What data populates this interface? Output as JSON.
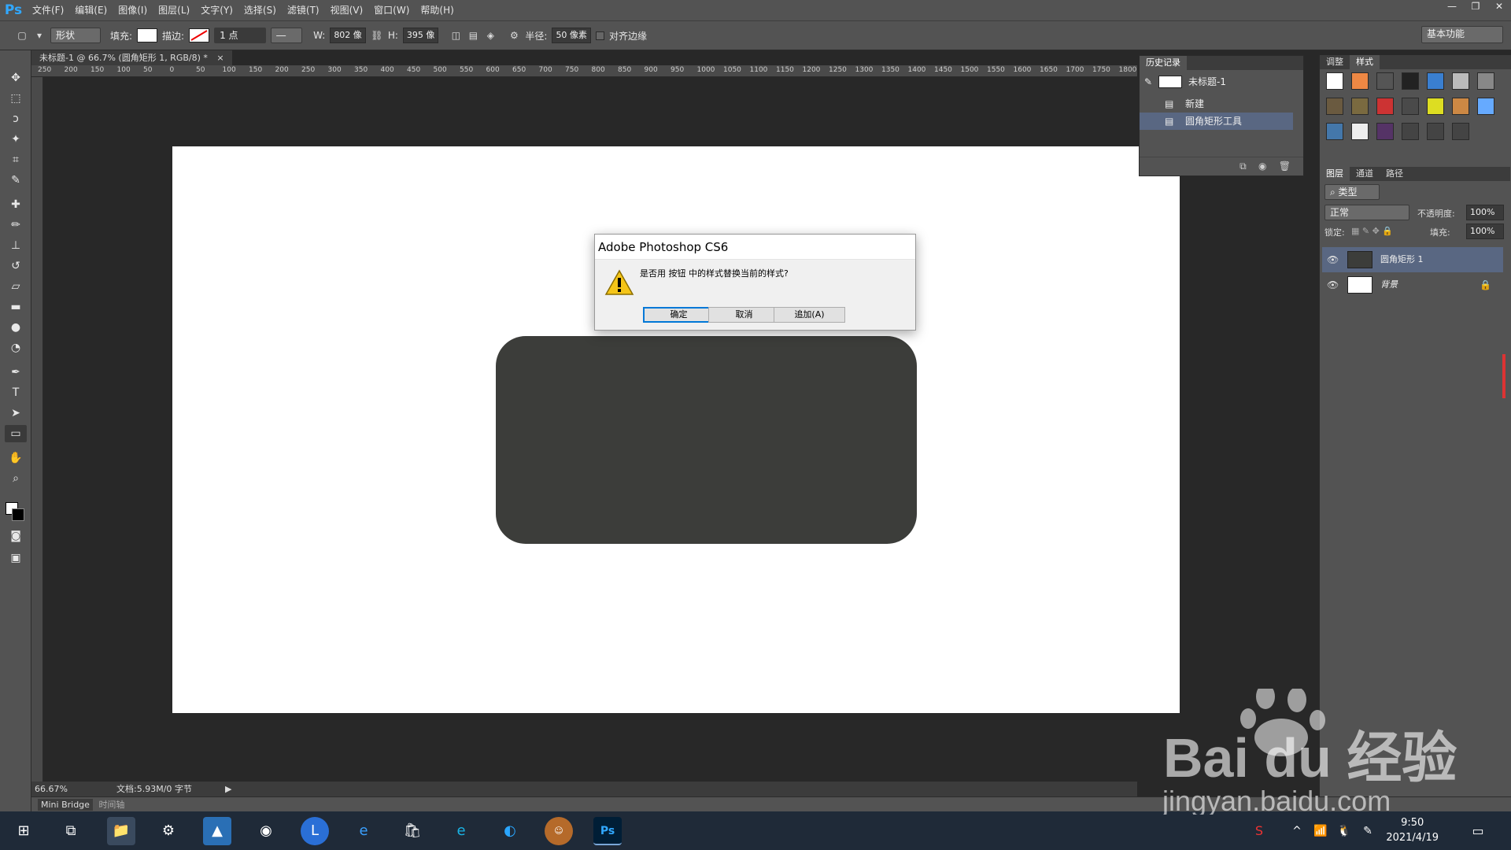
{
  "app": {
    "logo": "Ps"
  },
  "menu": [
    "文件(F)",
    "编辑(E)",
    "图像(I)",
    "图层(L)",
    "文字(Y)",
    "选择(S)",
    "滤镜(T)",
    "视图(V)",
    "窗口(W)",
    "帮助(H)"
  ],
  "window_controls": [
    "—",
    "❐",
    "✕"
  ],
  "options": {
    "mode": "形状",
    "fill_label": "填充:",
    "stroke_label": "描边:",
    "stroke_width": "1 点",
    "w_label": "W:",
    "w_value": "802 像",
    "h_label": "H:",
    "h_value": "395 像",
    "radius_label": "半径:",
    "radius_value": "50 像素",
    "align_edges": "对齐边缘",
    "workspace": "基本功能"
  },
  "document": {
    "tab": "未标题-1 @ 66.7% (圆角矩形 1, RGB/8) *",
    "zoom": "66.67%",
    "doc_info": "文档:5.93M/0 字节",
    "ruler_ticks": [
      "250",
      "200",
      "150",
      "100",
      "50",
      "0",
      "50",
      "100",
      "150",
      "200",
      "250",
      "300",
      "350",
      "400",
      "450",
      "500",
      "550",
      "600",
      "650",
      "700",
      "750",
      "800",
      "850",
      "900",
      "950",
      "1000",
      "1050",
      "1100",
      "1150",
      "1200",
      "1250",
      "1300",
      "1350",
      "1400",
      "1450",
      "1500",
      "1550",
      "1600",
      "1650",
      "1700",
      "1750",
      "1800"
    ]
  },
  "bottom_tabs": [
    "Mini Bridge",
    "时间轴"
  ],
  "dialog": {
    "title": "Adobe Photoshop CS6",
    "message": "是否用 按钮 中的样式替换当前的样式?",
    "ok": "确定",
    "cancel": "取消",
    "append": "追加(A)"
  },
  "history": {
    "tab": "历史记录",
    "snapshot": "未标题-1",
    "items": [
      "新建",
      "圆角矩形工具"
    ]
  },
  "styles_panel": {
    "tabs": [
      "调整",
      "样式"
    ]
  },
  "layers_panel": {
    "tabs": [
      "图层",
      "通道",
      "路径"
    ],
    "filter": "类型",
    "blend_mode": "正常",
    "opacity_label": "不透明度:",
    "opacity": "100%",
    "lock_label": "锁定:",
    "fill_label": "填充:",
    "fill": "100%",
    "layers": [
      "圆角矩形 1",
      "背景"
    ]
  },
  "taskbar": {
    "time": "9:50",
    "date": "2021/4/19"
  },
  "watermark": {
    "brand": "Bai du 经验",
    "url": "jingyan.baidu.com"
  },
  "colors": {
    "accent": "#31a8ff",
    "selection": "#596782",
    "shape_fill": "#3c3d3a"
  }
}
